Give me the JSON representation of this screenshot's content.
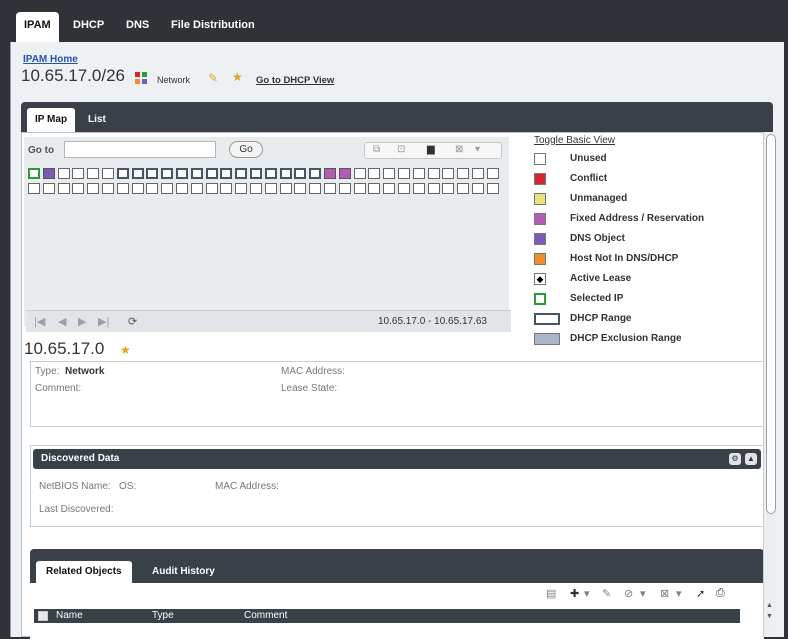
{
  "top_tabs": [
    {
      "label": "IPAM",
      "active": true
    },
    {
      "label": "DHCP"
    },
    {
      "label": "DNS"
    },
    {
      "label": "File Distribution"
    }
  ],
  "breadcrumb": "IPAM Home",
  "page_title": "10.65.17.0/26",
  "network_label": "Network",
  "dhcp_view_link": "Go to DHCP View",
  "sub_tabs": [
    {
      "label": "IP Map",
      "active": true
    },
    {
      "label": "List"
    }
  ],
  "goto": {
    "label": "Go to",
    "value": "",
    "button": "Go"
  },
  "ip_range": "10.65.17.0 - 10.65.17.63",
  "legend": {
    "toggle_link": "Toggle Basic View",
    "items": [
      {
        "label": "Unused",
        "color": "#ffffff"
      },
      {
        "label": "Conflict",
        "color": "#d8262a"
      },
      {
        "label": "Unmanaged",
        "color": "#e8e27a"
      },
      {
        "label": "Fixed Address / Reservation",
        "color": "#b35cb5"
      },
      {
        "label": "DNS Object",
        "color": "#7a5bb5"
      },
      {
        "label": "Host Not In DNS/DHCP",
        "color": "#f08c2a"
      },
      {
        "label": "Active Lease",
        "color": "#ffffff"
      },
      {
        "label": "Selected IP",
        "color": "#ffffff"
      },
      {
        "label": "DHCP Range",
        "color": "#ffffff"
      },
      {
        "label": "DHCP Exclusion Range",
        "color": "#aab7c9"
      }
    ]
  },
  "selected_ip": "10.65.17.0",
  "details": {
    "type_label": "Type:",
    "type_value": "Network",
    "comment_label": "Comment:",
    "mac_label": "MAC Address:",
    "lease_label": "Lease State:"
  },
  "discovered": {
    "title": "Discovered Data",
    "netbios_label": "NetBIOS Name:",
    "os_label": "OS:",
    "mac_label": "MAC Address:",
    "last_label": "Last Discovered:"
  },
  "related": {
    "tabs": [
      {
        "label": "Related Objects",
        "active": true
      },
      {
        "label": "Audit History"
      }
    ],
    "columns": [
      "Name",
      "Type",
      "Comment"
    ]
  }
}
